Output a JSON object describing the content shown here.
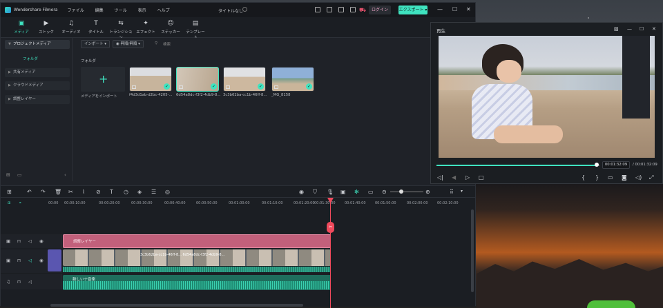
{
  "app": {
    "name": "Wondershare Filmora",
    "menu": [
      "ファイル",
      "編集",
      "ツール",
      "表示",
      "ヘルプ"
    ],
    "project_title": "タイトルなし",
    "login_label": "ログイン",
    "export_label": "エクスポート ▾"
  },
  "toolbar": {
    "items": [
      {
        "label": "メディア",
        "icon": "media-icon",
        "glyph": "▣"
      },
      {
        "label": "ストック",
        "icon": "stock-icon",
        "glyph": "▶"
      },
      {
        "label": "オーディオ",
        "icon": "audio-icon",
        "glyph": "♫"
      },
      {
        "label": "タイトル",
        "icon": "title-icon",
        "glyph": "T"
      },
      {
        "label": "トランジション",
        "icon": "transition-icon",
        "glyph": "⇆"
      },
      {
        "label": "エフェクト",
        "icon": "effect-icon",
        "glyph": "✦"
      },
      {
        "label": "ステッカー",
        "icon": "sticker-icon",
        "glyph": "☺"
      },
      {
        "label": "テンプレート",
        "icon": "template-icon",
        "glyph": "▤"
      }
    ]
  },
  "sidebar": {
    "items": [
      {
        "label": "プロジェクトメディア"
      },
      {
        "label": "共有メディア"
      },
      {
        "label": "クラウドメディア"
      },
      {
        "label": "調整レイヤー"
      }
    ],
    "sub_label": "フォルダ"
  },
  "media_panel": {
    "import_button": "インポート ▾",
    "filter_button": "◉ 昇順/昇順 ▾",
    "search_placeholder": "検索",
    "folder_label": "フォルダ",
    "import_caption": "メディアをインポート",
    "clips": [
      {
        "caption": "f4d3d1ab-d2bc-4205-...",
        "selected": false
      },
      {
        "caption": "6d54a8dc-f3f2-4db9-8...",
        "selected": true
      },
      {
        "caption": "3c3b62ba-cc1b-46ff-8...",
        "selected": false
      },
      {
        "caption": "_MG_8158",
        "selected": false
      }
    ]
  },
  "player": {
    "title": "再生",
    "current_time": "00:01:32:09",
    "total_time": "/ 00:01:32:09"
  },
  "timeline": {
    "ticks": [
      "00:00",
      "00:00:10:00",
      "00:00:20:00",
      "00:00:30:00",
      "00:00:40:00",
      "00:00:50:00",
      "00:01:00:00",
      "00:01:10:00",
      "00:01:20:00",
      "00:01:30:00",
      "00:01:40:00",
      "00:01:50:00",
      "00:02:00:00",
      "00:02:10:00"
    ],
    "adjustment_clip": "調整レイヤー",
    "video_clip_label": "3c3b62ba-cc1b-46ff-8... 6d54a8dc-f3f2-4db9-8...",
    "audio_clip": "新しいナ音楽"
  },
  "colors": {
    "accent": "#3fe3c0",
    "playhead": "#ef4a5c",
    "adjust_clip": "#c2607b"
  }
}
